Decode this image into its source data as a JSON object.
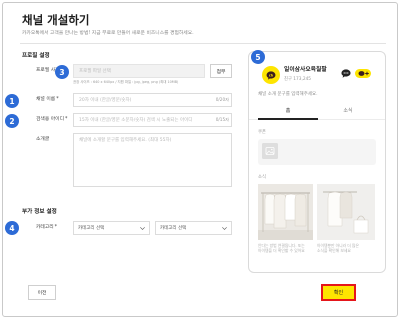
{
  "page": {
    "title": "채널 개설하기",
    "subtitle": "카카오톡에서 고객을 만나는 방법! 지금 무료로 만들어 새로운 비즈니스를 경험하세요."
  },
  "markers": [
    "1",
    "2",
    "3",
    "4",
    "5"
  ],
  "profile_section": {
    "heading": "프로필 설정",
    "photo": {
      "label": "프로필 사진",
      "placeholder": "프로필 파일 선택",
      "attach_label": "첨부",
      "hint": "권장 사이즈 : 640 x 640px / 지원 파일 : jpg, jpeg, png (최대 10MB)"
    },
    "name": {
      "label": "채널 이름",
      "required": "*",
      "placeholder": "20자 이내 (한글/영문/숫자)",
      "counter": "0/20자"
    },
    "search_id": {
      "label": "검색용 아이디",
      "required": "*",
      "placeholder": "15자 이내 (한글/영문 소문자/숫자) 검색 시 노출되는 아이디",
      "counter": "0/15자"
    },
    "intro": {
      "label": "소개글",
      "placeholder": "채널에 소개할 문구를 입력해주세요. (최대 55자)"
    }
  },
  "extra_section": {
    "heading": "부가 정보 설정",
    "category": {
      "label": "카테고리",
      "required": "*",
      "primary_select": "카테고리 선택",
      "secondary_select": "카테고리 선택"
    }
  },
  "preview": {
    "channel_name": "일이삼사오육칠팔",
    "friends": "친구 173,245",
    "intro": "채널 소개 문구를 입력해주세요.",
    "tabs": [
      {
        "label": "홈",
        "active": true
      },
      {
        "label": "소식",
        "active": false
      }
    ],
    "coupon_label": "쿠폰",
    "news_label": "소식",
    "posts": [
      {
        "line1": "안다는 방법 연결됩니다. 또는",
        "line2": "아이템을 더 확인할 수 있어요"
      },
      {
        "line1": "아이템뿐만 아니라 더 많은",
        "line2": "소식을 확인해 보세요"
      }
    ],
    "icons": {
      "avatar": "kakao-channel-logo",
      "chat": "chat-bubble-icon",
      "add": "channel-add-icon",
      "coupon_image": "image-placeholder-icon"
    }
  },
  "footer": {
    "prev_label": "이전",
    "confirm_label": "확인"
  },
  "colors": {
    "kakao_yellow": "#FEE500",
    "marker_blue": "#2D6BD6",
    "highlight_red": "#E5161B"
  }
}
